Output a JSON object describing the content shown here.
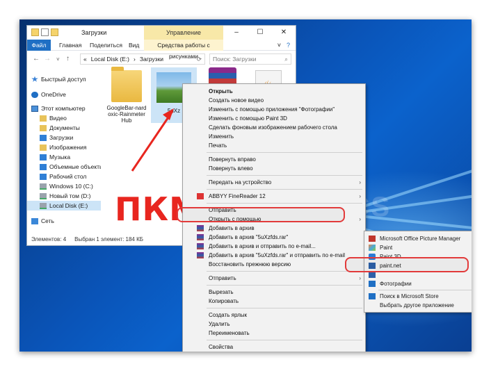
{
  "explorer": {
    "title": "Загрузки",
    "context_tab_header": "Управление",
    "ribbon_tabs": [
      "Файл",
      "Главная",
      "Поделиться",
      "Вид"
    ],
    "context_tab": "Средства работы с рисунками",
    "window_buttons": [
      "–",
      "☐",
      "✕"
    ],
    "address": {
      "prefix": "«",
      "parts": [
        "Local Disk (E:)",
        "Загрузки"
      ],
      "separator": "›"
    },
    "search_placeholder": "Поиск: Загрузки",
    "nav": [
      {
        "label": "Быстрый доступ",
        "icon": "quick-access-icon"
      },
      {
        "label": "OneDrive",
        "icon": "onedrive-icon"
      },
      {
        "label": "Этот компьютер",
        "icon": "computer-icon"
      },
      {
        "label": "Видео",
        "icon": "video-folder-icon"
      },
      {
        "label": "Документы",
        "icon": "documents-folder-icon"
      },
      {
        "label": "Загрузки",
        "icon": "downloads-folder-icon"
      },
      {
        "label": "Изображения",
        "icon": "pictures-folder-icon"
      },
      {
        "label": "Музыка",
        "icon": "music-folder-icon"
      },
      {
        "label": "Объемные объекты",
        "icon": "3d-objects-folder-icon"
      },
      {
        "label": "Рабочий стол",
        "icon": "desktop-folder-icon"
      },
      {
        "label": "Windows 10 (C:)",
        "icon": "drive-icon"
      },
      {
        "label": "Новый том (D:)",
        "icon": "drive-icon"
      },
      {
        "label": "Local Disk (E:)",
        "icon": "drive-icon",
        "selected": true
      },
      {
        "label": "Сеть",
        "icon": "network-icon"
      }
    ],
    "files": [
      {
        "name": "GoogleBar-nardoxic-RainmeterHub",
        "kind": "folder"
      },
      {
        "name": "5uXz",
        "kind": "image"
      },
      {
        "name": "",
        "kind": "rar"
      },
      {
        "name": "",
        "kind": "java"
      }
    ],
    "status": {
      "count": "Элементов: 4",
      "selected": "Выбран 1 элемент: 184 КБ"
    }
  },
  "context_menu": {
    "items": [
      {
        "label": "Открыть",
        "bold": true
      },
      {
        "label": "Создать новое видео"
      },
      {
        "label": "Изменить с помощью приложения \"Фотографии\""
      },
      {
        "label": "Изменить с помощью Paint 3D"
      },
      {
        "label": "Сделать фоновым изображением рабочего стола"
      },
      {
        "label": "Изменить"
      },
      {
        "label": "Печать"
      },
      {
        "separator": true
      },
      {
        "label": "Повернуть вправо"
      },
      {
        "label": "Повернуть влево"
      },
      {
        "separator": true
      },
      {
        "label": "Передать на устройство",
        "submenu": true
      },
      {
        "separator": true
      },
      {
        "label": "ABBYY FineReader 12",
        "submenu": true,
        "icon": "abbyy-icon"
      },
      {
        "separator": true
      },
      {
        "label": "Отправить"
      },
      {
        "label": "Открыть с помощью",
        "submenu": true,
        "highlighted": true
      },
      {
        "label": "Добавить в архив",
        "icon": "archive-icon"
      },
      {
        "label": "Добавить в архив \"5uXzfds.rar\"",
        "icon": "archive-icon"
      },
      {
        "label": "Добавить в архив и отправить по e-mail...",
        "icon": "archive-icon"
      },
      {
        "label": "Добавить в архив \"5uXzfds.rar\" и отправить по e-mail",
        "icon": "archive-icon"
      },
      {
        "label": "Восстановить прежнюю версию"
      },
      {
        "separator": true
      },
      {
        "label": "Отправить",
        "submenu": true
      },
      {
        "separator": true
      },
      {
        "label": "Вырезать"
      },
      {
        "label": "Копировать"
      },
      {
        "separator": true
      },
      {
        "label": "Создать ярлык"
      },
      {
        "label": "Удалить"
      },
      {
        "label": "Переименовать"
      },
      {
        "separator": true
      },
      {
        "label": "Свойства"
      }
    ]
  },
  "open_with_submenu": {
    "items": [
      {
        "label": "Microsoft Office Picture Manager",
        "icon": "picture-manager-icon"
      },
      {
        "label": "Paint",
        "icon": "paint-icon"
      },
      {
        "label": "Paint 3D",
        "icon": "paint-3d-icon"
      },
      {
        "label": "paint.net",
        "icon": "paint-net-icon"
      },
      {
        "label": "",
        "icon": "app-icon"
      },
      {
        "label": "Фотографии",
        "icon": "photos-icon",
        "highlighted": true
      },
      {
        "separator": true
      },
      {
        "label": "Поиск в Microsoft Store",
        "icon": "store-icon"
      },
      {
        "label": "Выбрать другое приложение"
      }
    ]
  },
  "annotation": {
    "label": "ПКМ",
    "color": "#e8261f"
  },
  "watermark": "LUMPICS",
  "colors": {
    "accent": "#1f6fc4",
    "highlight_ring": "#e23a3a",
    "menu_bg": "#f2f2f2"
  }
}
